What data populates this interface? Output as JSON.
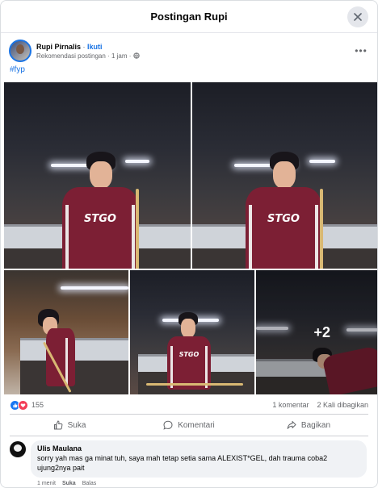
{
  "header": {
    "title": "Postingan Rupi"
  },
  "post": {
    "author": "Rupi Pirnalis",
    "separator": "·",
    "follow_label": "Ikuti",
    "meta": "Rekomendasi postingan · 1 jam ·",
    "hashtag": "#fyp",
    "more_photos_label": "+2",
    "photo_logo_text": "STGO"
  },
  "stats": {
    "reaction_count": "155",
    "comments": "1 komentar",
    "shares": "2 Kali dibagikan"
  },
  "actions": {
    "like": "Suka",
    "comment": "Komentari",
    "share": "Bagikan"
  },
  "comment": {
    "author": "Ulis Maulana",
    "text": "sorry yah mas ga minat tuh, saya mah tetap setia sama ALEXIST*GEL, dah trauma coba2 ujung2nya pait",
    "time": "1 menit",
    "like": "Suka",
    "reply": "Balas"
  },
  "icons": {
    "close": "close-icon",
    "globe": "globe-icon",
    "more": "more-options-icon",
    "like": "thumbs-up-icon",
    "love": "heart-icon",
    "comment": "comment-bubble-icon",
    "share": "share-arrow-icon"
  },
  "colors": {
    "accent": "#1b74e4",
    "jacket": "#7c1f34",
    "like_blue": "#1877f2",
    "love_red": "#f33e58"
  }
}
